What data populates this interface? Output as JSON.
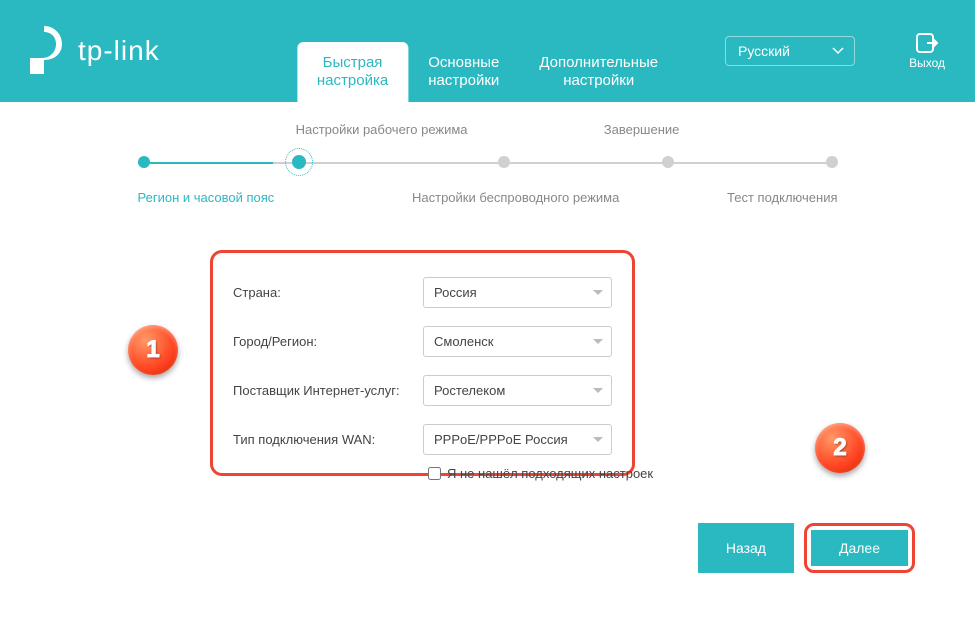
{
  "header": {
    "brand": "tp-link",
    "tabs": {
      "quick": "Быстрая\nнастройка",
      "basic": "Основные\nнастройки",
      "advanced": "Дополнительные\nнастройки"
    },
    "language": "Русский",
    "exit": "Выход"
  },
  "progress": {
    "top": {
      "mode": "Настройки рабочего режима",
      "finish": "Завершение"
    },
    "bottom": {
      "region": "Регион и часовой пояс",
      "wireless": "Настройки беспроводного режима",
      "test": "Тест подключения"
    }
  },
  "form": {
    "country_label": "Страна:",
    "country_value": "Россия",
    "city_label": "Город/Регион:",
    "city_value": "Смоленск",
    "isp_label": "Поставщик Интернет-услуг:",
    "isp_value": "Ростелеком",
    "wan_label": "Тип подключения WAN:",
    "wan_value": "PPPoE/PPPoE Россия",
    "not_found": "Я не нашёл подходящих настроек"
  },
  "buttons": {
    "back": "Назад",
    "next": "Далее"
  },
  "markers": {
    "one": "1",
    "two": "2"
  }
}
